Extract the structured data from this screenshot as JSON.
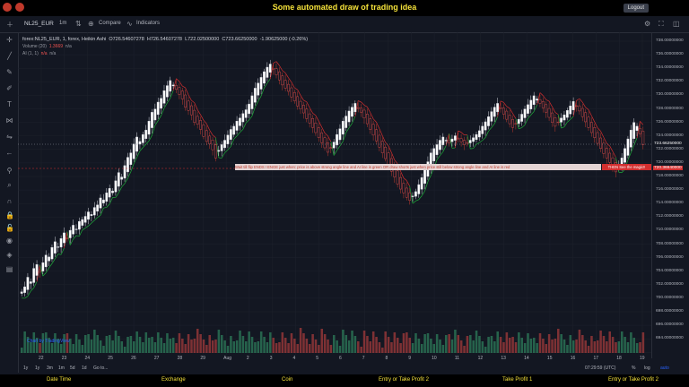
{
  "header": {
    "title": "Some automated draw of trading idea",
    "logout_label": "Logout"
  },
  "toolbar": {
    "symbol": "NL25_EUR",
    "timeframe": "1m",
    "compare_label": "Compare",
    "indicators_label": "Indicators"
  },
  "legend": {
    "main": "forex:NL25_EUR, 1, forex, Heikin Ashi",
    "o": "O726.54607278",
    "h": "H726.54607278",
    "l": "L722.02500000",
    "c": "C723.66250000",
    "chg": "-1.90625000 (-0.26%)",
    "volume": "Volume (20)",
    "volume_val": "1.3669",
    "volume_na": "n/a",
    "ai": "AI (1, 1)",
    "ai_na": "n/a",
    "ai_na2": "n/a"
  },
  "note": {
    "text": "Wait till flip ENDS !   ENGE just when:  price is above strong angle line and AI line is green        OR          draw shorts just when price still below strong angle line and AI line is red",
    "cta": "THEN See the magic!!"
  },
  "yaxis": {
    "labels": [
      "738.00000000",
      "736.00000000",
      "734.00000000",
      "732.00000000",
      "730.00000000",
      "728.00000000",
      "726.00000000",
      "724.00000000",
      "722.00000000",
      "720.00000000",
      "718.00000000",
      "716.00000000",
      "714.00000000",
      "712.00000000",
      "710.00000000",
      "708.00000000",
      "706.00000000",
      "704.00000000",
      "702.00000000",
      "700.00000000",
      "698.00000000",
      "696.00000000",
      "694.00000000"
    ],
    "current": "723.66250000",
    "marker": "720.36640000"
  },
  "xaxis": {
    "labels": [
      "22",
      "23",
      "24",
      "25",
      "26",
      "27",
      "28",
      "29",
      "Aug",
      "2",
      "3",
      "4",
      "5",
      "6",
      "7",
      "8",
      "9",
      "10",
      "11",
      "12",
      "13",
      "14",
      "15",
      "16",
      "17",
      "18",
      "19"
    ]
  },
  "bottom": {
    "ranges": [
      "1y",
      "1y",
      "3m",
      "1m",
      "5d",
      "1d",
      "Go to..."
    ],
    "time": "07:29:59 (UTC)",
    "pct": "%",
    "log": "log",
    "auto": "auto"
  },
  "watermark": "Chart by TradingView",
  "footer": {
    "cols": [
      "Date Time",
      "Exchange",
      "Coin",
      "Entry or Take Profit 2",
      "Take Profit 1",
      "Entry or Take Profit 2"
    ]
  },
  "chart_data": {
    "type": "candlestick",
    "style": "Heikin Ashi",
    "symbol": "NL25_EUR",
    "ylim": [
      692,
      740
    ],
    "close": [
      700.5,
      701.3,
      702.8,
      702.1,
      704.2,
      704.8,
      703.6,
      705.1,
      706.3,
      706.0,
      707.5,
      708.4,
      707.6,
      708.9,
      709.8,
      709.0,
      710.2,
      711.0,
      710.4,
      711.6,
      711.9,
      712.4,
      713.1,
      712.7,
      713.8,
      714.2,
      715.3,
      715.0,
      716.1,
      716.8,
      716.4,
      718.0,
      719.3,
      718.6,
      720.4,
      721.7,
      722.4,
      723.8,
      724.9,
      724.2,
      725.3,
      726.0,
      727.4,
      728.8,
      729.3,
      730.4,
      731.0,
      732.2,
      733.0,
      733.8,
      733.1,
      732.4,
      731.6,
      730.9,
      729.6,
      729.1,
      728.4,
      727.2,
      726.9,
      726.1,
      725.0,
      724.2,
      723.8,
      722.9,
      721.6,
      722.8,
      723.7,
      724.4,
      725.2,
      726.1,
      726.6,
      727.4,
      727.9,
      728.6,
      729.2,
      730.1,
      731.4,
      732.6,
      733.4,
      734.3,
      735.2,
      735.9,
      736.4,
      735.6,
      734.7,
      733.9,
      733.1,
      732.6,
      732.1,
      731.2,
      730.6,
      729.8,
      729.3,
      728.7,
      727.8,
      727.1,
      726.4,
      725.6,
      724.8,
      724.0,
      723.2,
      722.5,
      723.1,
      724.1,
      725.3,
      726.2,
      727.4,
      728.2,
      729.0,
      729.6,
      730.2,
      729.4,
      728.8,
      727.9,
      727.0,
      726.1,
      725.2,
      724.3,
      723.3,
      722.4,
      721.5,
      720.6,
      719.5,
      718.6,
      717.5,
      716.7,
      716.1,
      715.4,
      714.9,
      715.6,
      716.3,
      717.4,
      718.5,
      719.8,
      721.0,
      722.4,
      723.1,
      723.7,
      724.4,
      724.9,
      724.4,
      724.0,
      724.6,
      725.1,
      724.6,
      724.1,
      723.7,
      723.9,
      724.4,
      724.8,
      725.3,
      725.9,
      726.6,
      727.3,
      728.1,
      728.9,
      729.6,
      730.2,
      729.4,
      728.5,
      727.7,
      727.0,
      726.4,
      727.0,
      727.7,
      728.5,
      729.3,
      730.0,
      730.7,
      731.4,
      730.9,
      730.2,
      729.5,
      728.8,
      728.0,
      727.2,
      726.6,
      727.2,
      727.9,
      728.4,
      729.1,
      729.8,
      730.5,
      729.8,
      729.0,
      728.1,
      727.3,
      726.4,
      725.6,
      724.8,
      723.9,
      723.1,
      722.3,
      721.6,
      720.9,
      720.1,
      719.4,
      720.3,
      721.6,
      723.1,
      724.6,
      726.0,
      727.2,
      726.6,
      725.4,
      723.66
    ]
  }
}
